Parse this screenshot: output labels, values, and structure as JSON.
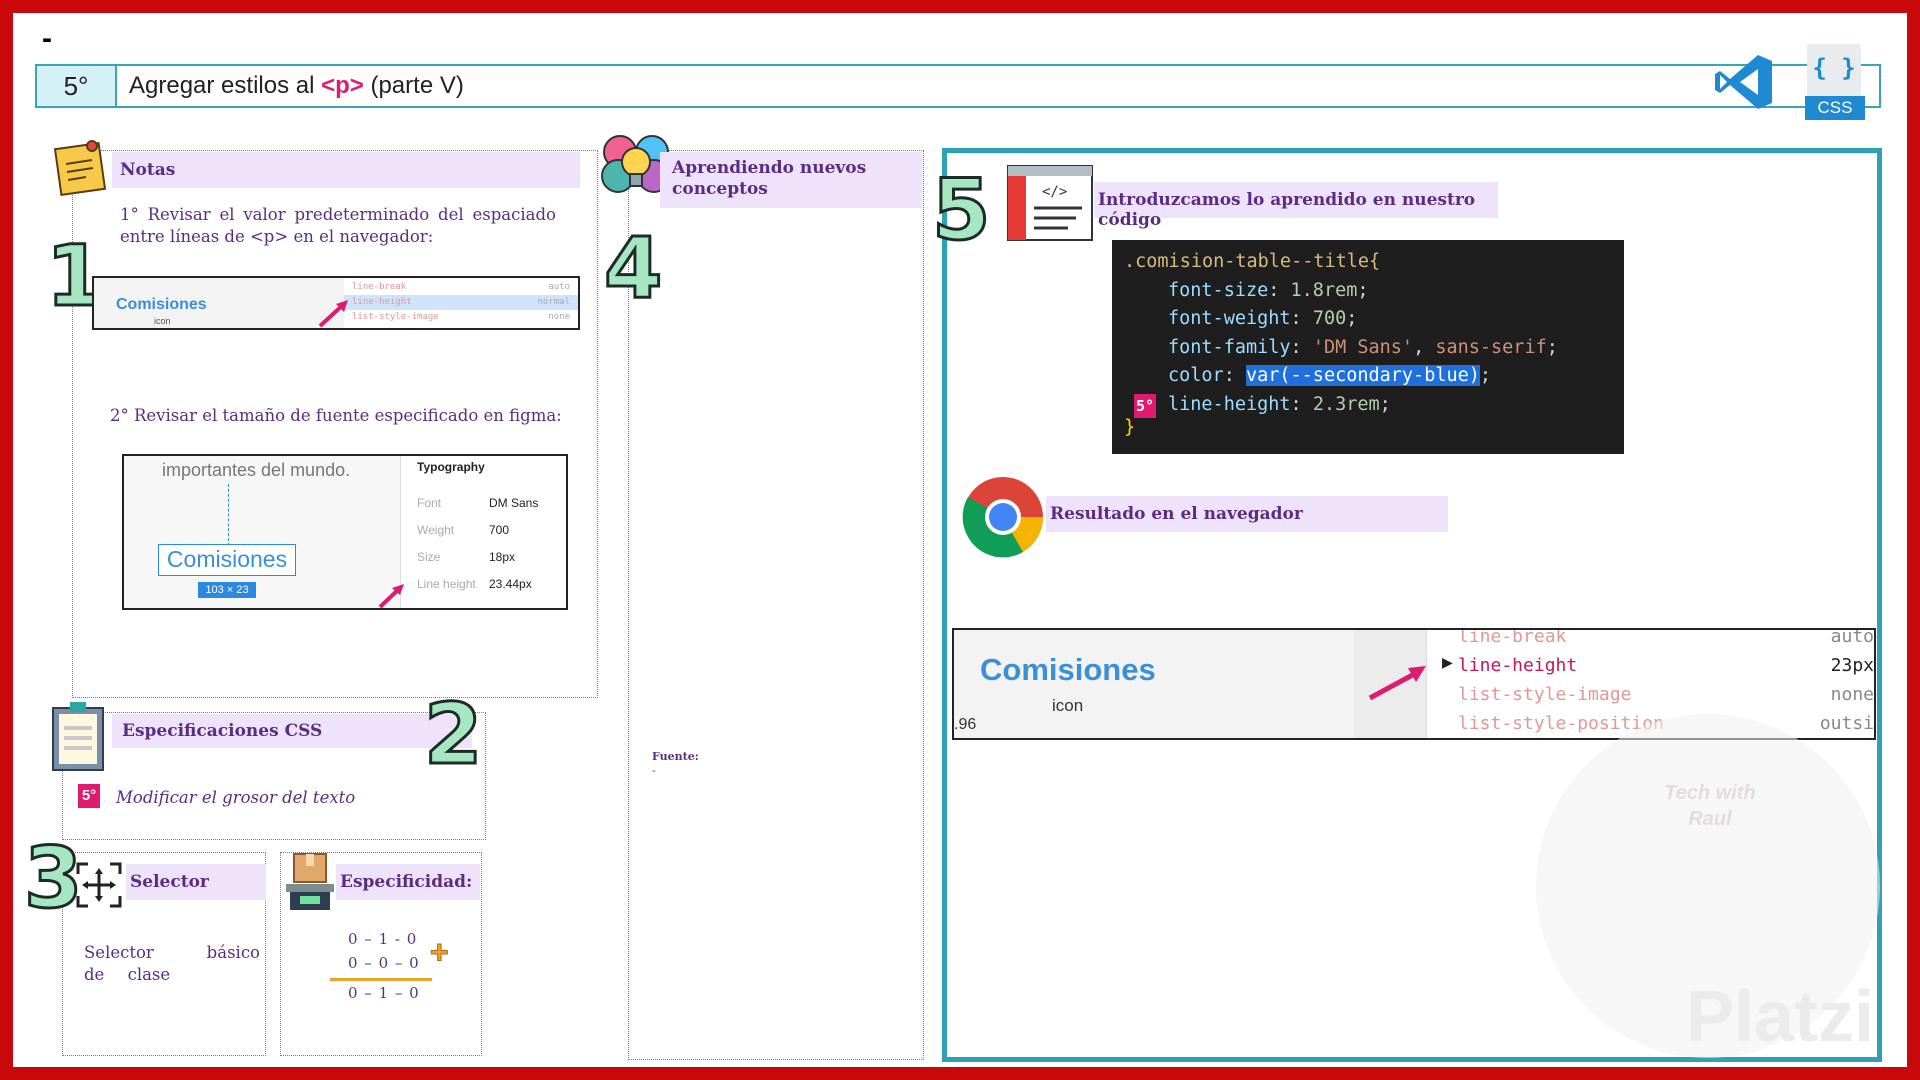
{
  "header": {
    "dash": "-",
    "step": "5°",
    "title_pre": "Agregar estilos al ",
    "title_tag": "<p>",
    "title_post": " (parte V)",
    "css_badge": "CSS",
    "css_braces": "{ }"
  },
  "notes": {
    "heading": "Notas",
    "number": "1",
    "item1": "1° Revisar el valor predeterminado del espaciado entre líneas de <p> en el navegador:",
    "item2": "2° Revisar el tamaño de fuente especificado en figma:",
    "devtools_small": {
      "element_text": "Comisiones",
      "element_sub": "icon",
      "rows": [
        {
          "prop": "line-break",
          "value": "auto"
        },
        {
          "prop": "line-height",
          "value": "normal"
        },
        {
          "prop": "list-style-image",
          "value": "none"
        }
      ]
    },
    "figma": {
      "top_text": "importantes del mundo.",
      "selected_text": "Comisiones",
      "size_badge": "103 × 23",
      "panel_title": "Typography",
      "rows": [
        {
          "label": "Font",
          "value": "DM Sans"
        },
        {
          "label": "Weight",
          "value": "700"
        },
        {
          "label": "Size",
          "value": "18px"
        },
        {
          "label": "Line height",
          "value": "23.44px"
        }
      ]
    }
  },
  "spec": {
    "heading": "Especificaciones CSS",
    "number": "2",
    "badge": "5°",
    "item": "Modificar el grosor del texto"
  },
  "selector": {
    "number": "3",
    "heading": "Selector",
    "text": "Selector básico de clase"
  },
  "specificity": {
    "heading": "Especificidad:",
    "row1": "0 – 1 - 0",
    "row2": "0 – 0 – 0",
    "result": "0 – 1 – 0",
    "plus": "+"
  },
  "learning": {
    "heading": "Aprendiendo nuevos conceptos",
    "number": "4",
    "source_label": "Fuente:",
    "source_value": "-"
  },
  "code_section": {
    "number": "5",
    "heading": "Introduzcamos lo aprendido en nuestro código",
    "lines": {
      "l1": ".comision-table--title{",
      "p2": "font-size",
      "v2": "1.8rem",
      "p3": "font-weight",
      "v3": "700",
      "p4": "font-family",
      "v4a": "'DM Sans'",
      "v4b": "sans-serif",
      "p5": "color",
      "v5": "var(--secondary-blue)",
      "p6": "line-height",
      "v6": "2.3rem",
      "close": "}"
    },
    "badge": "5°"
  },
  "result": {
    "heading": "Resultado en el navegador",
    "element_text": "Comisiones",
    "element_sub": "icon",
    "coord": ".96",
    "rows": [
      {
        "prop": "line-break",
        "value": "auto"
      },
      {
        "prop": "line-height",
        "value": "23px"
      },
      {
        "prop": "list-style-image",
        "value": "none"
      },
      {
        "prop": "list-style-position",
        "value": "outsi"
      }
    ]
  },
  "watermark": {
    "text": "Platzi",
    "logo_text": "Tech with Raul"
  },
  "colors": {
    "frame": "#c8080a",
    "accent_teal": "#3aa6b4",
    "accent_pink": "#e01a6f",
    "purple_heading": "#5a2d82",
    "heading_bg": "#efe2fb",
    "code_bg": "#1e1e1e"
  }
}
